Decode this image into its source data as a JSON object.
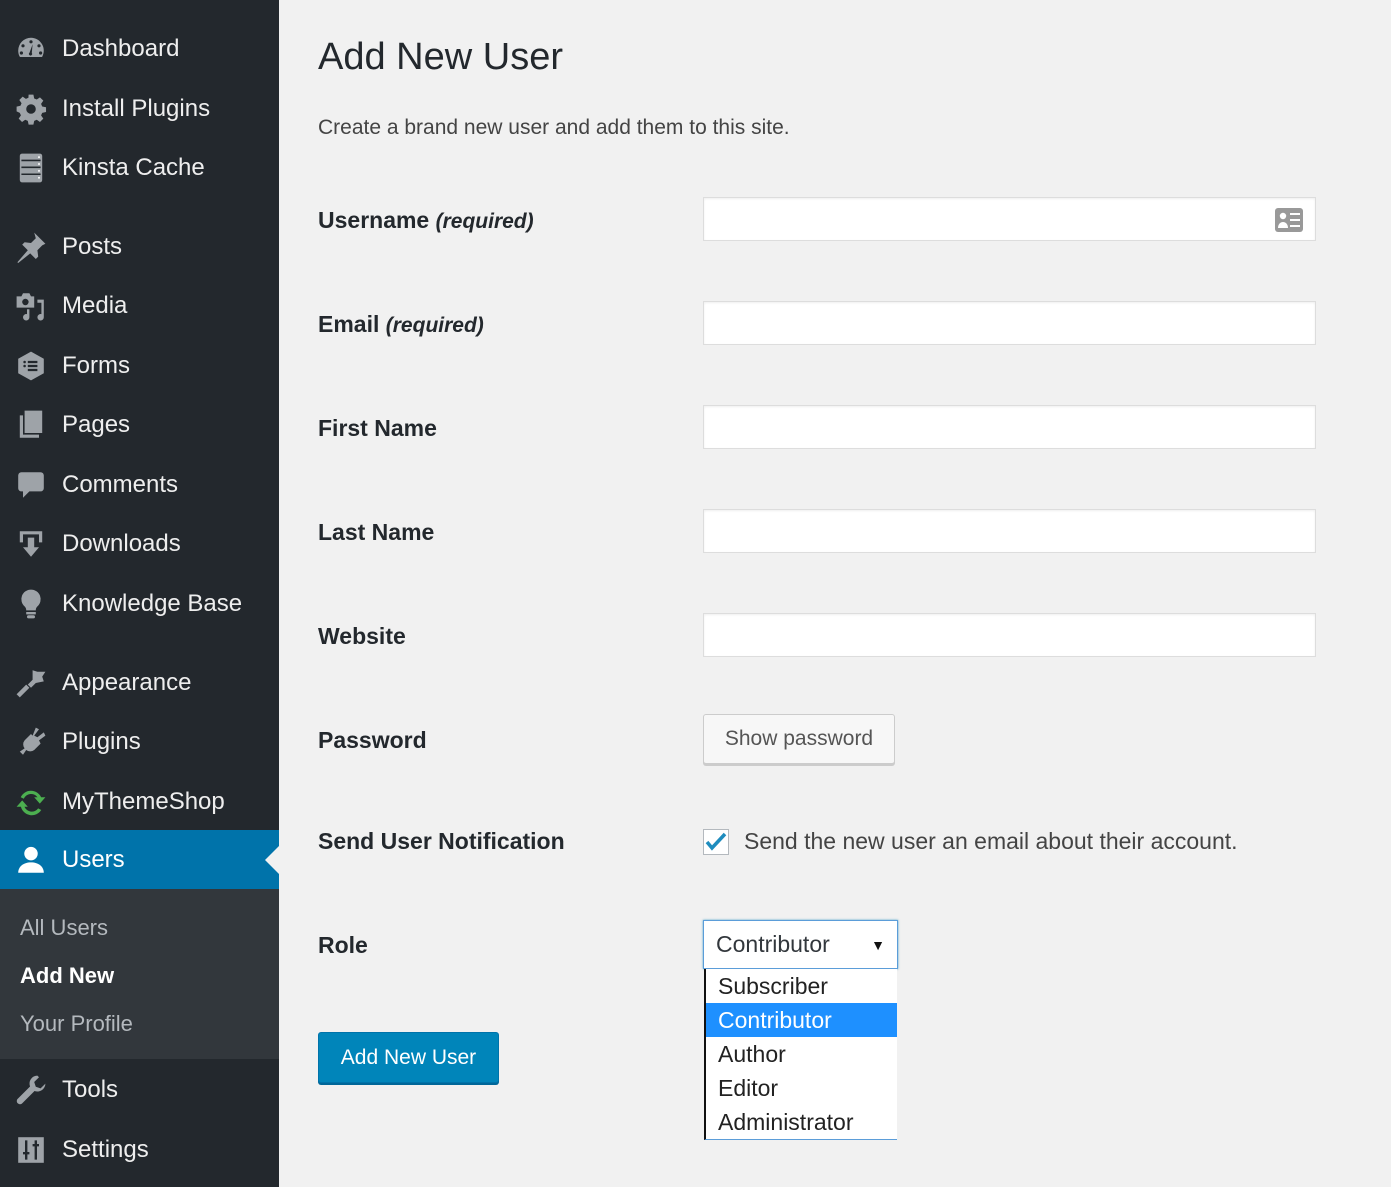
{
  "sidebar": {
    "menu": [
      {
        "label": "Dashboard",
        "icon": "dashboard-icon"
      },
      {
        "label": "Install Plugins",
        "icon": "gear-icon"
      },
      {
        "label": "Kinsta Cache",
        "icon": "server-icon"
      },
      {
        "label": "Posts",
        "icon": "pushpin-icon"
      },
      {
        "label": "Media",
        "icon": "media-icon"
      },
      {
        "label": "Forms",
        "icon": "forms-icon"
      },
      {
        "label": "Pages",
        "icon": "pages-icon"
      },
      {
        "label": "Comments",
        "icon": "comment-icon"
      },
      {
        "label": "Downloads",
        "icon": "download-icon"
      },
      {
        "label": "Knowledge Base",
        "icon": "lightbulb-icon"
      },
      {
        "label": "Appearance",
        "icon": "paintbrush-icon"
      },
      {
        "label": "Plugins",
        "icon": "plug-icon"
      },
      {
        "label": "MyThemeShop",
        "icon": "refresh-icon"
      },
      {
        "label": "Users",
        "icon": "user-icon",
        "active": true
      },
      {
        "label": "Tools",
        "icon": "wrench-icon"
      },
      {
        "label": "Settings",
        "icon": "sliders-icon"
      }
    ],
    "submenu": [
      {
        "label": "All Users"
      },
      {
        "label": "Add New",
        "current": true
      },
      {
        "label": "Your Profile"
      }
    ]
  },
  "page": {
    "title": "Add New User",
    "description": "Create a brand new user and add them to this site."
  },
  "form": {
    "username": {
      "label": "Username",
      "note": "(required)",
      "value": ""
    },
    "email": {
      "label": "Email",
      "note": "(required)",
      "value": ""
    },
    "first_name": {
      "label": "First Name",
      "value": ""
    },
    "last_name": {
      "label": "Last Name",
      "value": ""
    },
    "website": {
      "label": "Website",
      "value": ""
    },
    "password": {
      "label": "Password",
      "button": "Show password"
    },
    "notification": {
      "label": "Send User Notification",
      "checkbox_label": "Send the new user an email about their account.",
      "checked": true
    },
    "role": {
      "label": "Role",
      "selected": "Contributor",
      "options": [
        "Subscriber",
        "Contributor",
        "Author",
        "Editor",
        "Administrator"
      ]
    },
    "submit": "Add New User"
  },
  "colors": {
    "sidebar_bg": "#23282d",
    "active_bg": "#0073aa",
    "primary_button": "#0085ba",
    "highlight_option": "#1e90ff"
  }
}
